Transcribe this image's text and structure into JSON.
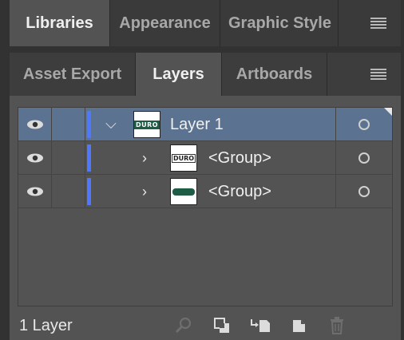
{
  "top_panel": {
    "tabs": [
      {
        "label": "Libraries",
        "active": true
      },
      {
        "label": "Appearance",
        "active": false
      },
      {
        "label": "Graphic Style",
        "active": false
      }
    ],
    "menu_icon": "hamburger-menu-icon"
  },
  "bottom_panel": {
    "tabs": [
      {
        "label": "Asset Export",
        "active": false
      },
      {
        "label": "Layers",
        "active": true
      },
      {
        "label": "Artboards",
        "active": false
      }
    ],
    "menu_icon": "hamburger-menu-icon"
  },
  "layers": [
    {
      "name": "Layer 1",
      "expanded": true,
      "selected": true,
      "thumb_text": "DURO",
      "visible": true
    },
    {
      "name": "<Group>",
      "expanded": false,
      "selected": false,
      "thumb_text": "DURO",
      "visible": true
    },
    {
      "name": "<Group>",
      "expanded": false,
      "selected": false,
      "thumb_text": "",
      "visible": true
    }
  ],
  "footer": {
    "count_text": "1 Layer",
    "icons": [
      "locate-object-icon",
      "make-clipping-mask-icon",
      "create-sublayer-icon",
      "create-new-layer-icon",
      "delete-icon"
    ]
  },
  "colors": {
    "layer_color": "#4d78ff",
    "selected_row": "#5b7290",
    "panel_bg": "#535353",
    "logo_green": "#1e5c46"
  }
}
